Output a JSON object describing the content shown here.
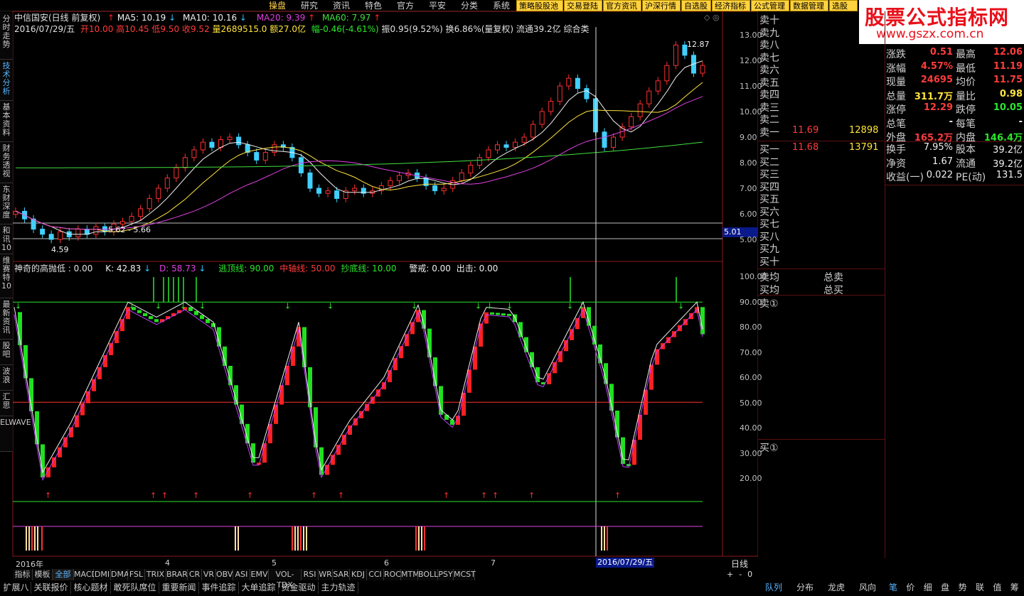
{
  "top_menu": {
    "items": [
      "操盘",
      "研究",
      "资讯",
      "特色",
      "官方",
      "平安",
      "分类",
      "系统"
    ],
    "active": "操盘",
    "buttons": [
      "策略股股池",
      "交易登陆",
      "官方资讯",
      "沪深行情",
      "自选股",
      "经济指标",
      "公式管理",
      "数据管理",
      "选股"
    ]
  },
  "watermark": {
    "line1": "股票公式指标网",
    "line2": "www.gszx.com.cn"
  },
  "left_tabs": [
    "分时走势",
    "技术分析",
    "基本资料",
    "财务透视",
    "东财深度",
    "和讯10",
    "维赛特10",
    "最新资讯",
    "股吧",
    "波浪",
    "汇思",
    "ELWAVE"
  ],
  "left_tabs_active": "技术分析",
  "header": {
    "stock": "中信国安(日线 前复权)",
    "ma5": "MA5: 10.19",
    "ma10": "MA10: 10.16",
    "ma20": "MA20: 9.39",
    "ma60": "MA60: 7.97",
    "line2_date": "2016/07/29/五",
    "open": "开10.00",
    "high": "高10.45",
    "low": "低9.50",
    "close": "收9.52",
    "vol": "量2689515.0",
    "amount": "额27.0亿",
    "change": "幅-0.46(-4.61%)",
    "amp": "振0.95(9.52%)",
    "turnover": "换6.86%(量复权)",
    "float": "流通39.2亿",
    "category": "综合类"
  },
  "indicator_header": {
    "name": "神奇的高抛低 : 0.00",
    "k": "K: 42.83",
    "d": "D: 58.73",
    "top_line": "逃顶线: 90.00",
    "mid_line": "中轴线: 50.00",
    "bottom_line": "抄底线: 10.00",
    "warn": "警戒: 0.00",
    "exit": "出击: 0.00"
  },
  "price_axis": [
    "13.00",
    "12.00",
    "11.00",
    "10.00",
    "9.00",
    "8.00",
    "7.00",
    "6.00",
    "5.00"
  ],
  "price_marker": "5.01",
  "annotations": {
    "high": "12.87",
    "low": "4.59",
    "range": "5.62 - 5.66"
  },
  "ind_axis": [
    "100.00",
    "90.00",
    "80.00",
    "70.00",
    "60.00",
    "50.00",
    "40.00",
    "30.00",
    "20.00"
  ],
  "x_axis": {
    "labels": [
      "2016年",
      "4",
      "5",
      "6",
      "7"
    ],
    "cursor_date": "2016/07/29/五",
    "period": "日线"
  },
  "chart_data": {
    "type": "line",
    "candles_close": [
      6.1,
      5.8,
      5.4,
      5.2,
      5.0,
      5.3,
      5.1,
      5.4,
      5.2,
      5.5,
      5.3,
      5.6,
      5.7,
      5.9,
      6.2,
      6.6,
      7.0,
      7.4,
      7.8,
      8.2,
      8.5,
      8.8,
      8.6,
      8.9,
      9.0,
      8.7,
      8.4,
      8.1,
      8.4,
      8.7,
      8.6,
      8.2,
      7.6,
      7.0,
      6.8,
      6.9,
      6.6,
      6.9,
      7.0,
      6.8,
      6.9,
      7.1,
      7.3,
      7.5,
      7.6,
      7.4,
      7.1,
      6.9,
      7.0,
      7.3,
      7.6,
      7.9,
      8.2,
      8.5,
      8.7,
      8.6,
      8.8,
      9.0,
      9.5,
      10.0,
      10.4,
      11.0,
      11.3,
      10.9,
      10.5,
      9.2,
      8.6,
      9.0,
      9.4,
      9.8,
      10.3,
      10.8,
      11.2,
      11.8,
      12.6,
      12.2,
      11.5,
      11.8
    ],
    "ma_bands": {
      "ma60_start": 8.0,
      "ma60_end": 9.1
    }
  },
  "quote": {
    "asks": [
      "卖十",
      "卖九",
      "卖八",
      "卖七",
      "卖六",
      "卖五",
      "卖四",
      "卖三",
      "卖二",
      "卖一"
    ],
    "ask1_price": "11.69",
    "ask1_vol": "12898",
    "bids": [
      "买一",
      "买二",
      "买三",
      "买四",
      "买五",
      "买六",
      "买七",
      "买八",
      "买九",
      "买十"
    ],
    "bid1_price": "11.68",
    "bid1_vol": "13791",
    "avg_labels": [
      "卖均",
      "买均"
    ],
    "total_labels": [
      "总卖",
      "总买"
    ],
    "sell_queue": "卖①",
    "buy_queue": "买①",
    "stats": [
      {
        "l1": "涨跌",
        "v1": "0.51",
        "c1": "qred",
        "l2": "最高",
        "v2": "12.06",
        "c2": "qred"
      },
      {
        "l1": "涨幅",
        "v1": "4.57%",
        "c1": "qred",
        "l2": "最低",
        "v2": "11.19",
        "c2": "qred"
      },
      {
        "l1": "现量",
        "v1": "24695",
        "c1": "qred",
        "l2": "均价",
        "v2": "11.75",
        "c2": "qred"
      },
      {
        "l1": "总量",
        "v1": "311.7万",
        "c1": "qyellow",
        "l2": "量比",
        "v2": "0.98",
        "c2": "qyellow"
      },
      {
        "l1": "涨停",
        "v1": "12.29",
        "c1": "qred",
        "l2": "跌停",
        "v2": "10.05",
        "c2": "qgreen"
      },
      {
        "l1": "总笔",
        "v1": "-",
        "c1": "qwhite",
        "l2": "每笔",
        "v2": "-",
        "c2": "qwhite"
      },
      {
        "l1": "外盘",
        "v1": "165.2万",
        "c1": "qred",
        "l2": "内盘",
        "v2": "146.4万",
        "c2": "qgreen"
      }
    ],
    "stats2": [
      {
        "l1": "换手",
        "v1": "7.95%",
        "l2": "股本",
        "v2": "39.2亿"
      },
      {
        "l1": "净资",
        "v1": "1.67",
        "l2": "流通",
        "v2": "39.2亿"
      },
      {
        "l1": "收益(一)",
        "v1": "0.022",
        "l2": "PE(动)",
        "v2": "131.5"
      }
    ]
  },
  "indicator_tabs": [
    "指标",
    "模板",
    "全部",
    "MACD",
    "DMI",
    "DMA",
    "FSL",
    "TRIX",
    "BRAR",
    "CR",
    "VR",
    "OBV",
    "ASI",
    "EMV",
    "VOL-TDX",
    "RSI",
    "WR",
    "SAR",
    "KDJ",
    "CCI",
    "ROC",
    "MTM",
    "BOLL",
    "PSY",
    "MCST"
  ],
  "indicator_tabs_active": "全部",
  "bottom_tabs": [
    "扩展八",
    "关联报价",
    "核心题材",
    "敢死队席位",
    "重要新闻",
    "事件追踪",
    "大单追踪",
    "资金驱动",
    "主力轨迹"
  ],
  "right_tabs": [
    "队列",
    "分布",
    "龙虎",
    "风向"
  ],
  "right_small_tabs": [
    "笔",
    "价",
    "细",
    "盘",
    "势",
    "联",
    "值",
    "筹"
  ],
  "right_small_active": "笔"
}
